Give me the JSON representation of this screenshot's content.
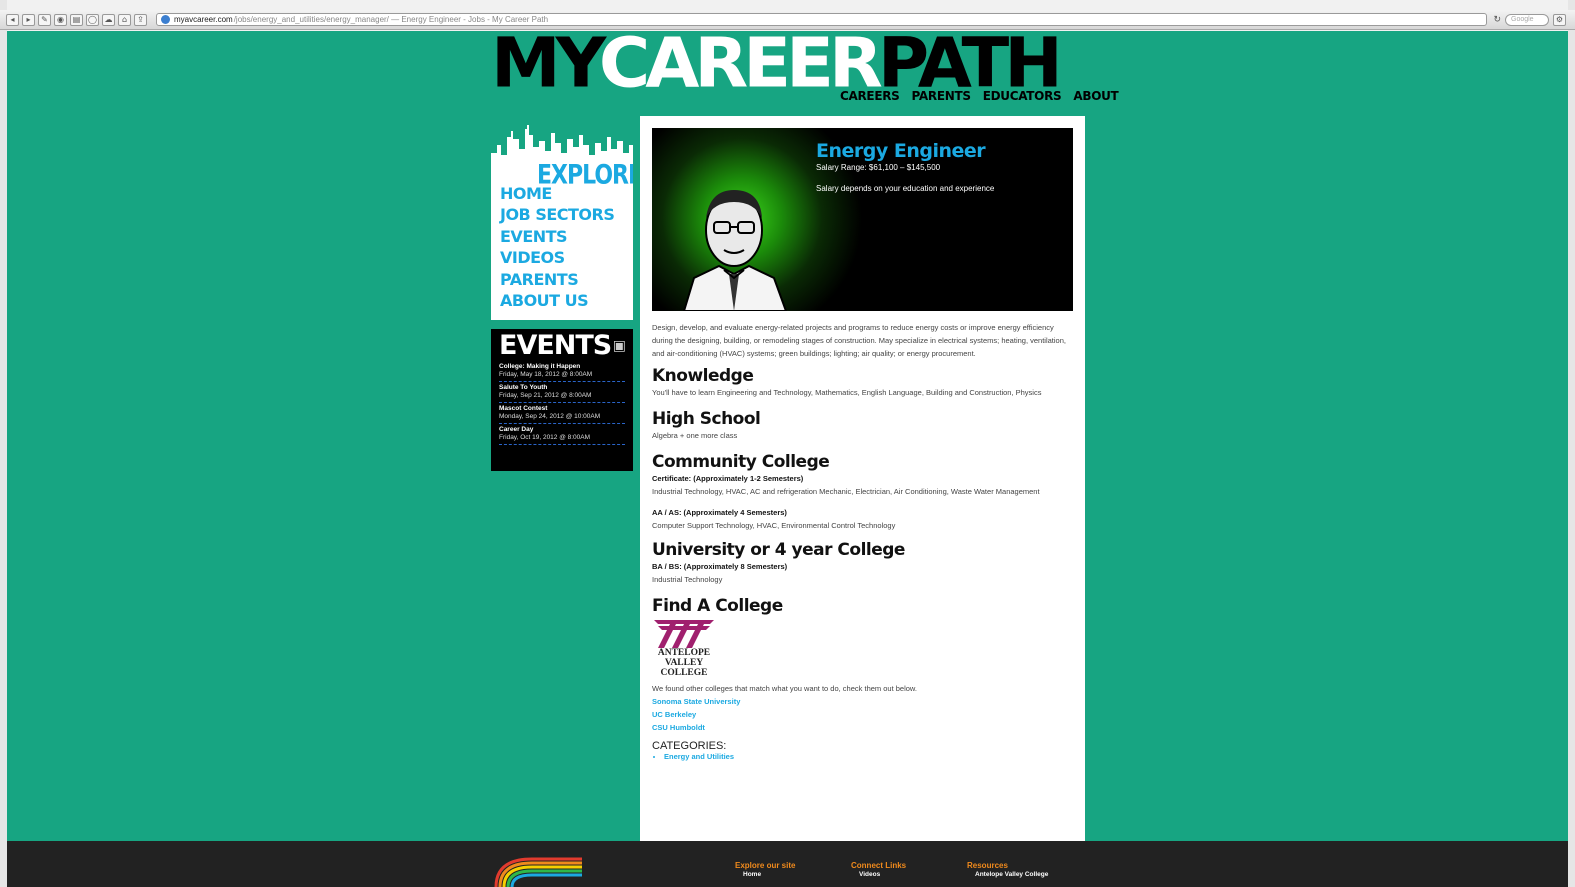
{
  "browser": {
    "domain": "myavcareer.com",
    "path": "/jobs/energy_and_utilities/energy_manager/ — Energy Engineer - Jobs - My Career Path",
    "search_placeholder": "Google"
  },
  "logo": {
    "my": "MY",
    "career": "CAREER",
    "path": "PATH"
  },
  "topnav": [
    "CAREERS",
    "PARENTS",
    "EDUCATORS",
    "ABOUT"
  ],
  "explore": {
    "title": "EXPLORE",
    "items": [
      "HOME",
      "JOB SECTORS",
      "EVENTS",
      "VIDEOS",
      "PARENTS",
      "ABOUT US"
    ]
  },
  "events": {
    "title": "EVENTS",
    "items": [
      {
        "title": "College: Making it Happen",
        "date": "Friday, May 18, 2012 @ 8:00AM"
      },
      {
        "title": "Salute To Youth",
        "date": "Friday, Sep 21, 2012 @ 8:00AM"
      },
      {
        "title": "Mascot Contest",
        "date": "Monday, Sep 24, 2012 @ 10:00AM"
      },
      {
        "title": "Career Day",
        "date": "Friday, Oct 19, 2012 @ 8:00AM"
      }
    ]
  },
  "job": {
    "title": "Energy Engineer",
    "salary": "Salary Range: $61,100 – $145,500",
    "salary_note": "Salary depends on your education and experience",
    "description": "Design, develop, and evaluate energy-related projects and programs to reduce energy costs or improve energy efficiency during the designing, building, or remodeling stages of construction. May specialize in electrical systems; heating, ventilation, and air-conditioning (HVAC) systems; green buildings; lighting; air quality; or energy procurement."
  },
  "knowledge": {
    "heading": "Knowledge",
    "text": "You'll have to learn Engineering and Technology, Mathematics, English Language, Building and Construction, Physics"
  },
  "high_school": {
    "heading": "High School",
    "text": "Algebra + one more class"
  },
  "community_college": {
    "heading": "Community College",
    "cert_label": "Certificate: (Approximately 1-2 Semesters)",
    "cert_text": "Industrial Technology, HVAC, AC and refrigeration Mechanic, Electrician, Air Conditioning, Waste Water Management",
    "aa_label": "AA / AS: (Approximately 4 Semesters)",
    "aa_text": "Computer Support Technology, HVAC, Environmental Control Technology"
  },
  "university": {
    "heading": "University or 4 year College",
    "ba_label": "BA / BS: (Approximately 8 Semesters)",
    "ba_text": "Industrial Technology"
  },
  "find_college": {
    "heading": "Find A College",
    "logo_lines": [
      "ANTELOPE",
      "VALLEY",
      "COLLEGE"
    ],
    "intro": "We found other colleges that match what you want to do, check them out below.",
    "links": [
      "Sonoma State University",
      "UC Berkeley",
      "CSU Humboldt"
    ]
  },
  "categories": {
    "heading": "CATEGORIES:",
    "items": [
      "Energy and Utilities"
    ]
  },
  "footer": {
    "columns": [
      {
        "heading": "Explore our site",
        "items": [
          "Home"
        ]
      },
      {
        "heading": "Connect Links",
        "items": [
          "Videos"
        ]
      },
      {
        "heading": "Resources",
        "items": [
          "Antelope Valley College"
        ]
      }
    ]
  },
  "colors": {
    "page_bg": "#17a582",
    "accent_blue": "#1ba9e1",
    "footer_orange": "#f08a1c"
  }
}
